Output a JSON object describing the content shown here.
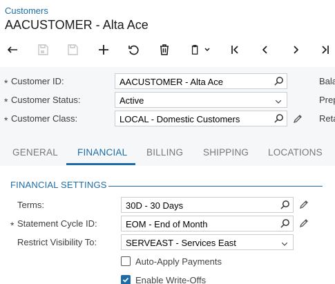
{
  "breadcrumb": "Customers",
  "title": "AACUSTOMER - Alta Ace",
  "toolbar": [
    {
      "name": "undo-icon",
      "disabled": false
    },
    {
      "name": "save-close-icon",
      "disabled": true
    },
    {
      "name": "save-icon",
      "disabled": true
    },
    {
      "name": "add-icon",
      "disabled": false
    },
    {
      "name": "refresh-icon",
      "disabled": false
    },
    {
      "name": "delete-icon",
      "disabled": false
    },
    {
      "name": "copy-paste-icon",
      "disabled": false
    },
    {
      "name": "first-record-icon",
      "disabled": false
    },
    {
      "name": "previous-record-icon",
      "disabled": false
    },
    {
      "name": "next-record-icon",
      "disabled": false
    },
    {
      "name": "last-record-icon",
      "disabled": false
    }
  ],
  "summary": {
    "customer_id": {
      "label": "Customer ID:",
      "value": "AACUSTOMER - Alta Ace",
      "required": "*"
    },
    "customer_status": {
      "label": "Customer Status:",
      "value": "Active",
      "required": "*"
    },
    "customer_class": {
      "label": "Customer Class:",
      "value": "LOCAL - Domestic Customers",
      "required": "*"
    },
    "right_labels": [
      "Bala",
      "Prep",
      "Reta"
    ]
  },
  "tabs": [
    "GENERAL",
    "FINANCIAL",
    "BILLING",
    "SHIPPING",
    "LOCATIONS"
  ],
  "active_tab": "FINANCIAL",
  "financial": {
    "section_title": "FINANCIAL SETTINGS",
    "terms": {
      "label": "Terms:",
      "value": "30D - 30 Days"
    },
    "statement_cycle": {
      "label": "Statement Cycle ID:",
      "value": "EOM - End of Month",
      "required": "*"
    },
    "restrict_visibility": {
      "label": "Restrict Visibility To:",
      "value": "SERVEAST - Services East"
    },
    "auto_apply": {
      "label": "Auto-Apply Payments",
      "checked": false
    },
    "enable_writeoffs": {
      "label": "Enable Write-Offs",
      "checked": true
    }
  },
  "colors": {
    "accent": "#1b6ca8",
    "summary_bg": "#f6f7f8"
  }
}
